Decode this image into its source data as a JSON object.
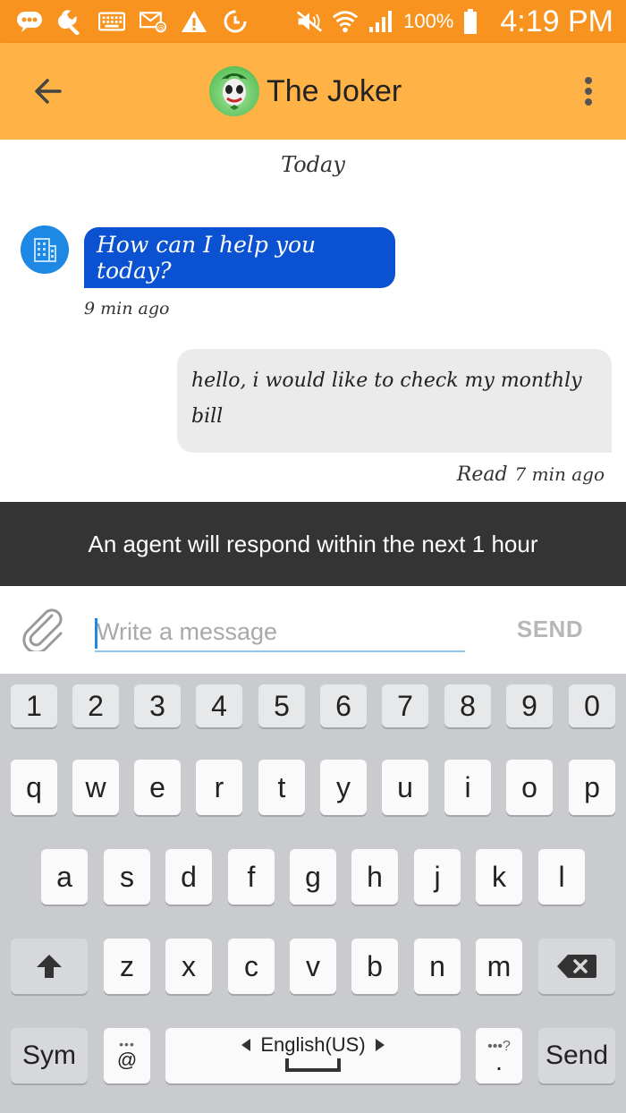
{
  "status_bar": {
    "battery": "100%",
    "time": "4:19 PM",
    "icons": [
      "messenger-icon",
      "wrench-icon",
      "keyboard-icon",
      "email-icon",
      "warning-icon",
      "sync-icon",
      "mute-icon",
      "wifi-icon",
      "signal-icon",
      "battery-icon"
    ]
  },
  "header": {
    "title": "The Joker",
    "back_icon": "arrow-left-icon",
    "menu_icon": "more-vertical-icon"
  },
  "chat": {
    "date_label": "Today",
    "messages": [
      {
        "sender": "agent",
        "text": "How can I help you today?",
        "time": "9 min ago"
      },
      {
        "sender": "me",
        "text": "hello, i would like to check my monthly bill",
        "status": "Read",
        "time": "7 min ago"
      }
    ]
  },
  "banner": {
    "text": "An agent will respond within the next  1 hour"
  },
  "composer": {
    "placeholder": "Write a message",
    "value": "",
    "send_label": "SEND"
  },
  "keyboard": {
    "row_numbers": [
      "1",
      "2",
      "3",
      "4",
      "5",
      "6",
      "7",
      "8",
      "9",
      "0"
    ],
    "row1": [
      "q",
      "w",
      "e",
      "r",
      "t",
      "y",
      "u",
      "i",
      "o",
      "p"
    ],
    "row2": [
      "a",
      "s",
      "d",
      "f",
      "g",
      "h",
      "j",
      "k",
      "l"
    ],
    "row3": [
      "z",
      "x",
      "c",
      "v",
      "b",
      "n",
      "m"
    ],
    "sym_label": "Sym",
    "at_label": "@",
    "language_label": "English(US)",
    "period_label": ".",
    "send_label": "Send"
  },
  "colors": {
    "status_bar": "#f7931e",
    "app_bar": "#ffb347",
    "agent_bubble": "#0a52d1",
    "my_bubble": "#ebebeb",
    "banner": "#343434",
    "keyboard_bg": "#c9cbce"
  }
}
